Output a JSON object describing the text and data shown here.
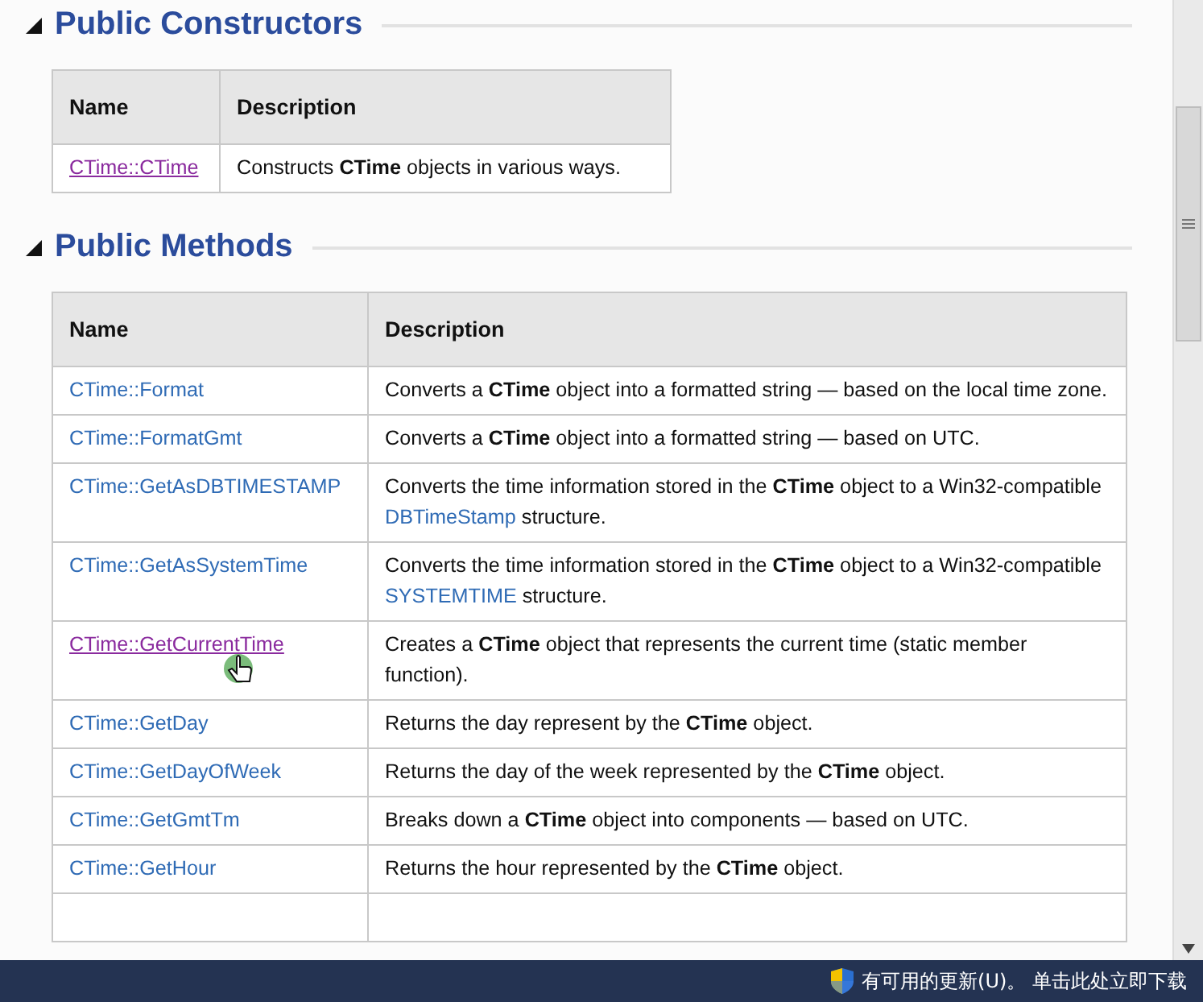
{
  "sections": [
    {
      "title": "Public Constructors",
      "columns": [
        "Name",
        "Description"
      ],
      "rows": [
        {
          "name": "CTime::CTime",
          "visited": true,
          "description": [
            {
              "kind": "text",
              "text": "Constructs **CTime** objects in various ways."
            }
          ]
        }
      ]
    },
    {
      "title": "Public Methods",
      "columns": [
        "Name",
        "Description"
      ],
      "rows": [
        {
          "name": "CTime::Format",
          "visited": false,
          "description": [
            {
              "kind": "text",
              "text": "Converts a **CTime** object into a formatted string — based on the local time zone."
            }
          ]
        },
        {
          "name": "CTime::FormatGmt",
          "visited": false,
          "description": [
            {
              "kind": "text",
              "text": "Converts a **CTime** object into a formatted string — based on UTC."
            }
          ]
        },
        {
          "name": "CTime::GetAsDBTIMESTAMP",
          "visited": false,
          "description": [
            {
              "kind": "text",
              "text": "Converts the time information stored in the **CTime** object to a Win32-compatible "
            },
            {
              "kind": "link",
              "text": "DBTimeStamp"
            },
            {
              "kind": "text",
              "text": " structure."
            }
          ]
        },
        {
          "name": "CTime::GetAsSystemTime",
          "visited": false,
          "description": [
            {
              "kind": "text",
              "text": "Converts the time information stored in the **CTime** object to a Win32-compatible "
            },
            {
              "kind": "link",
              "text": "SYSTEMTIME"
            },
            {
              "kind": "text",
              "text": " structure."
            }
          ]
        },
        {
          "name": "CTime::GetCurrentTime",
          "visited": true,
          "description": [
            {
              "kind": "text",
              "text": "Creates a **CTime** object that represents the current time (static member function)."
            }
          ]
        },
        {
          "name": "CTime::GetDay",
          "visited": false,
          "description": [
            {
              "kind": "text",
              "text": "Returns the day represent by the **CTime** object."
            }
          ]
        },
        {
          "name": "CTime::GetDayOfWeek",
          "visited": false,
          "description": [
            {
              "kind": "text",
              "text": "Returns the day of the week represented by the **CTime** object."
            }
          ]
        },
        {
          "name": "CTime::GetGmtTm",
          "visited": false,
          "description": [
            {
              "kind": "text",
              "text": "Breaks down a **CTime** object into components — based on UTC."
            }
          ]
        },
        {
          "name": "CTime::GetHour",
          "visited": false,
          "description": [
            {
              "kind": "text",
              "text": "Returns the hour represented by the **CTime** object."
            }
          ]
        }
      ]
    }
  ],
  "notification": {
    "text": "有可用的更新(U)。 单击此处立即下载"
  }
}
